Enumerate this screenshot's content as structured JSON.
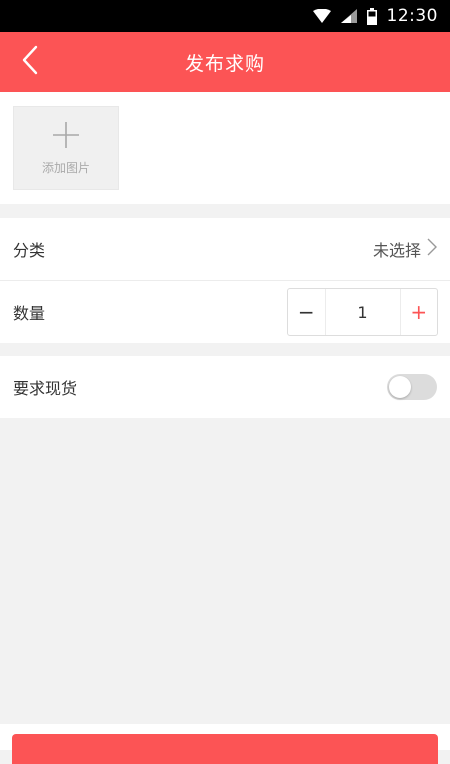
{
  "status_bar": {
    "time": "12:30"
  },
  "header": {
    "title": "发布求购"
  },
  "photo": {
    "add_label": "添加图片"
  },
  "form": {
    "category": {
      "label": "分类",
      "value": "未选择"
    },
    "quantity": {
      "label": "数量",
      "value": "1",
      "minus": "−",
      "plus": "+"
    }
  },
  "stock": {
    "label": "要求现货",
    "enabled": false
  },
  "colors": {
    "accent": "#fc5455",
    "background": "#f2f2f2",
    "status_bar": "#000000"
  }
}
